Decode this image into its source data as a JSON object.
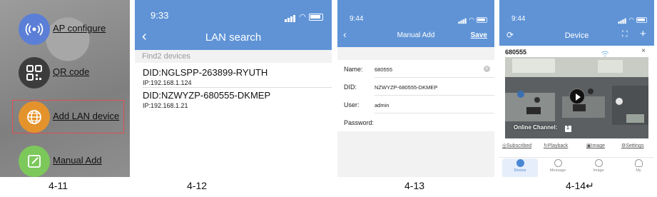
{
  "panel1": {
    "items": [
      {
        "label": "AP configure",
        "icon": "wifi-signal-icon",
        "color": "#5b7fd6"
      },
      {
        "label": "QR code",
        "icon": "qr-code-icon",
        "color": "#3c3c3c"
      },
      {
        "label": "Add LAN device",
        "icon": "globe-icon",
        "color": "#e4932c"
      },
      {
        "label": "Manual Add",
        "icon": "edit-icon",
        "color": "#7cc85b"
      }
    ],
    "caption": "4-11"
  },
  "panel2": {
    "time": "9:33",
    "title": "LAN search",
    "section": "Find2 devices",
    "devices": [
      {
        "did": "DID:NGLSPP-263899-RYUTH",
        "ip": "IP:192.168.1.124"
      },
      {
        "did": "DID:NZWYZP-680555-DKMEP",
        "ip": "IP:192.168.1.21"
      }
    ],
    "caption": "4-12"
  },
  "panel3": {
    "time": "9:44",
    "title": "Manual Add",
    "save": "Save",
    "fields": [
      {
        "label": "Name:",
        "value": "680555"
      },
      {
        "label": "DID:",
        "value": "NZWYZP-680555-DKMEP"
      },
      {
        "label": "User:",
        "value": "admin"
      },
      {
        "label": "Password:",
        "value": ""
      }
    ],
    "caption": "4-13"
  },
  "panel4": {
    "time": "9:44",
    "title": "Device",
    "device_name": "680555",
    "online_channel": "Online Channel: ",
    "channel_count": "1",
    "actions": [
      "Subscribed",
      "Playback",
      "Image",
      "Settings"
    ],
    "tabs": [
      "Device",
      "Message",
      "Image",
      "My"
    ],
    "caption": "4-14↵"
  },
  "colors": {
    "header_blue": "#5f93d6",
    "highlight_red": "#e05050",
    "active_tab": "#4a86d4"
  }
}
